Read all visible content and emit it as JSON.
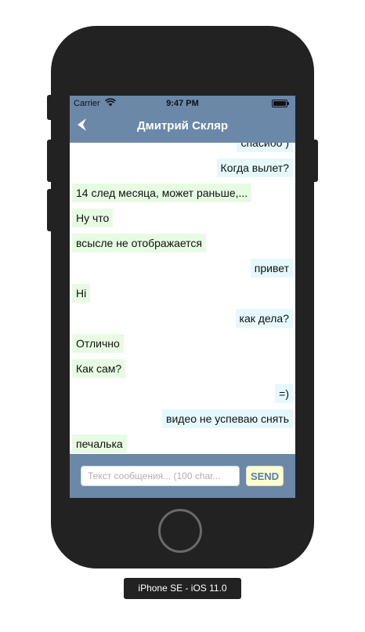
{
  "status_bar": {
    "carrier": "Carrier",
    "time": "9:47 PM"
  },
  "header": {
    "title": "Дмитрий Скляр"
  },
  "messages": [
    {
      "text": "спасибо )",
      "side": "out"
    },
    {
      "text": "Когда вылет?",
      "side": "out"
    },
    {
      "text": "14 след месяца, может раньше,...",
      "side": "in"
    },
    {
      "text": "Ну что",
      "side": "in"
    },
    {
      "text": "всысле не отображается",
      "side": "in"
    },
    {
      "text": "привет",
      "side": "out"
    },
    {
      "text": "Hi",
      "side": "in"
    },
    {
      "text": "как дела?",
      "side": "out"
    },
    {
      "text": "Отлично",
      "side": "in"
    },
    {
      "text": "Как сам?",
      "side": "in"
    },
    {
      "text": "=)",
      "side": "out"
    },
    {
      "text": "видео не успеваю снять",
      "side": "out"
    },
    {
      "text": "печалька",
      "side": "in"
    }
  ],
  "composer": {
    "placeholder": "Текст сообщения... (100 char...",
    "send_label": "SEND"
  },
  "device_label": "iPhone SE - iOS 11.0",
  "colors": {
    "accent": "#6b88a8",
    "incoming_bubble": "#e7fbe3",
    "outgoing_bubble": "#e5f8fd",
    "send_button": "#fbfbd6"
  }
}
